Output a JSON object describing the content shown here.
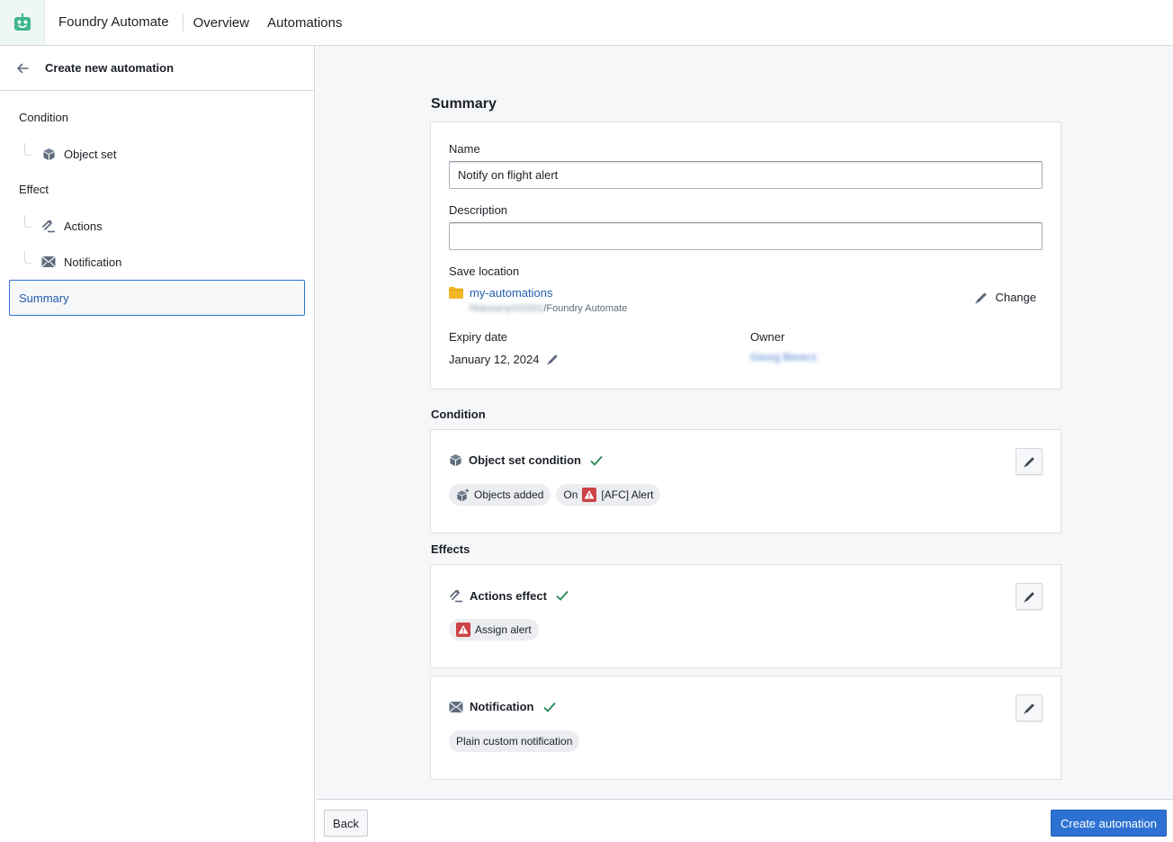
{
  "header": {
    "app_title": "Foundry Automate",
    "nav": [
      "Overview",
      "Automations"
    ],
    "logo_icon": "robot-icon",
    "logo_color": "#3fb68b"
  },
  "sidebar": {
    "title": "Create new automation",
    "back_icon": "arrow-left-icon",
    "sections": [
      {
        "label": "Condition",
        "items": [
          {
            "label": "Object set",
            "icon": "cube-icon"
          }
        ]
      },
      {
        "label": "Effect",
        "items": [
          {
            "label": "Actions",
            "icon": "actions-icon"
          },
          {
            "label": "Notification",
            "icon": "envelope-icon"
          }
        ]
      }
    ],
    "active_item": "Summary"
  },
  "summary": {
    "heading": "Summary",
    "name_label": "Name",
    "name_value": "Notify on flight alert",
    "description_label": "Description",
    "description_value": "",
    "save_location_label": "Save location",
    "folder_name": "my-automations",
    "path_blurred": "/Wareany/0/2002",
    "path_suffix": "/Foundry Automate",
    "change_label": "Change",
    "expiry_label": "Expiry date",
    "expiry_value": "January 12, 2024",
    "owner_label": "Owner",
    "owner_value": "Georg Berecz"
  },
  "condition": {
    "heading": "Condition",
    "card_title": "Object set condition",
    "tags": [
      {
        "label": "Objects added",
        "icon": "cube-add-icon"
      },
      {
        "prefix": "On",
        "label": "[AFC] Alert",
        "icon": "warning-icon"
      }
    ]
  },
  "effects": {
    "heading": "Effects",
    "cards": [
      {
        "title": "Actions effect",
        "icon": "actions-icon",
        "tags": [
          {
            "label": "Assign alert",
            "icon": "warning-icon"
          }
        ]
      },
      {
        "title": "Notification",
        "icon": "envelope-icon",
        "tags": [
          {
            "label": "Plain custom notification"
          }
        ]
      }
    ]
  },
  "footer": {
    "back_label": "Back",
    "create_label": "Create automation"
  },
  "colors": {
    "primary": "#2d72d2",
    "success": "#238551",
    "warning_tag": "#cd4246",
    "folder": "#f0b726"
  }
}
